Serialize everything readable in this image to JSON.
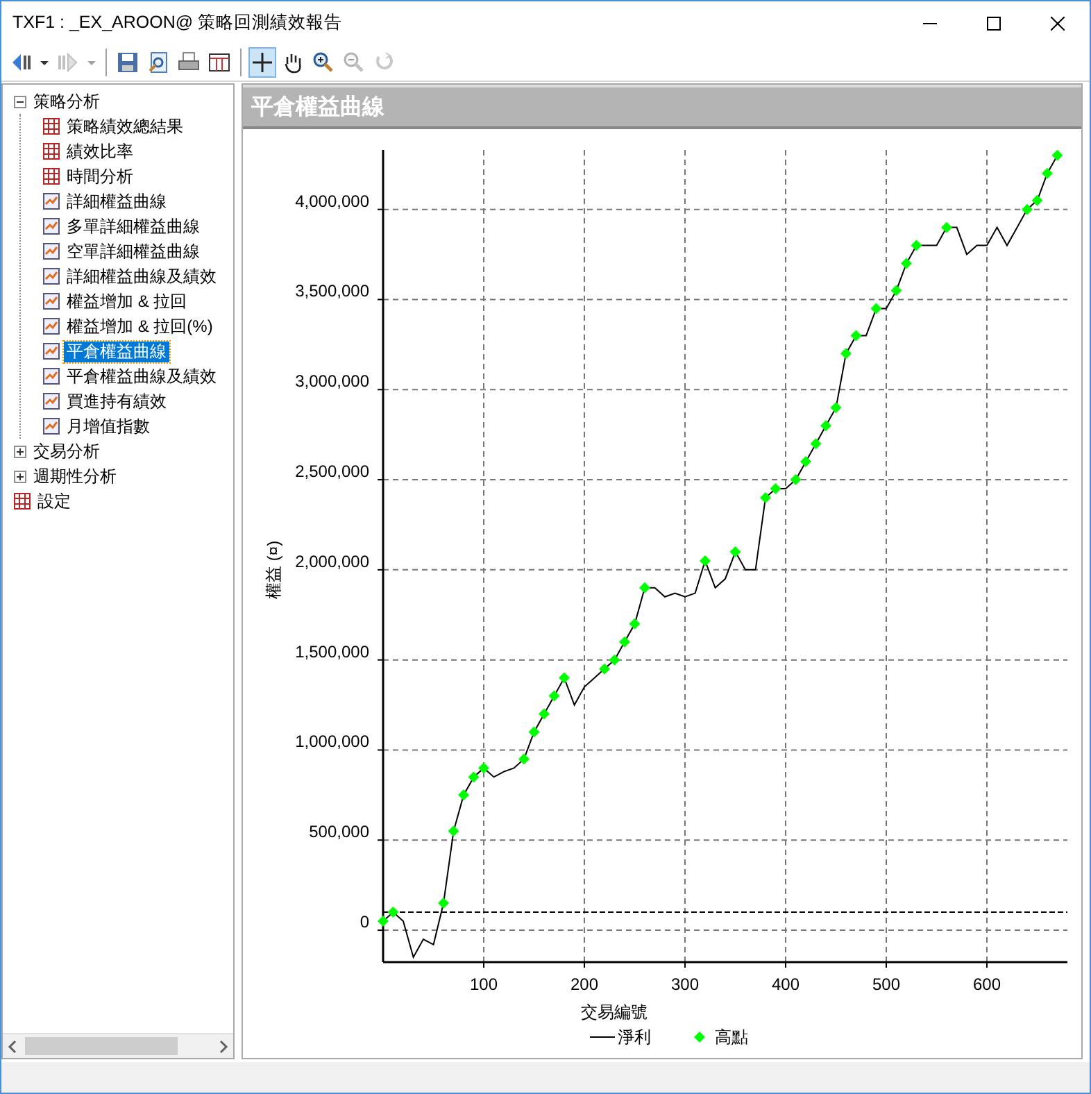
{
  "window": {
    "title": "TXF1 : _EX_AROON@ 策略回測績效報告"
  },
  "toolbar": [
    {
      "kind": "back",
      "selected": false,
      "disabled": false
    },
    {
      "kind": "dropdown",
      "selected": false,
      "disabled": false
    },
    {
      "kind": "forward",
      "selected": false,
      "disabled": true
    },
    {
      "kind": "dropdown",
      "selected": false,
      "disabled": true
    },
    {
      "kind": "separator"
    },
    {
      "kind": "save",
      "selected": false,
      "disabled": false
    },
    {
      "kind": "preview",
      "selected": false,
      "disabled": false
    },
    {
      "kind": "print",
      "selected": false,
      "disabled": false
    },
    {
      "kind": "table",
      "selected": false,
      "disabled": false
    },
    {
      "kind": "separator"
    },
    {
      "kind": "crosshair",
      "selected": true,
      "disabled": false
    },
    {
      "kind": "hand",
      "selected": false,
      "disabled": false
    },
    {
      "kind": "zoom-in",
      "selected": false,
      "disabled": false
    },
    {
      "kind": "zoom-out",
      "selected": false,
      "disabled": true
    },
    {
      "kind": "reset",
      "selected": false,
      "disabled": true
    }
  ],
  "tree": [
    {
      "label": "策略分析",
      "kind": "group",
      "expanded": true,
      "selected": false,
      "children": [
        {
          "label": "策略績效總結果",
          "kind": "table",
          "selected": false
        },
        {
          "label": "績效比率",
          "kind": "table",
          "selected": false
        },
        {
          "label": "時間分析",
          "kind": "table",
          "selected": false
        },
        {
          "label": "詳細權益曲線",
          "kind": "chart",
          "selected": false
        },
        {
          "label": "多單詳細權益曲線",
          "kind": "chart",
          "selected": false
        },
        {
          "label": "空單詳細權益曲線",
          "kind": "chart",
          "selected": false
        },
        {
          "label": "詳細權益曲線及績效",
          "kind": "chart",
          "selected": false
        },
        {
          "label": "權益增加 & 拉回",
          "kind": "chart",
          "selected": false
        },
        {
          "label": "權益增加 & 拉回(%)",
          "kind": "chart",
          "selected": false
        },
        {
          "label": "平倉權益曲線",
          "kind": "chart",
          "selected": true
        },
        {
          "label": "平倉權益曲線及績效",
          "kind": "chart",
          "selected": false
        },
        {
          "label": "買進持有績效",
          "kind": "chart",
          "selected": false
        },
        {
          "label": "月增值指數",
          "kind": "chart",
          "selected": false
        }
      ]
    },
    {
      "label": "交易分析",
      "kind": "group",
      "expanded": false,
      "selected": false
    },
    {
      "label": "週期性分析",
      "kind": "group",
      "expanded": false,
      "selected": false
    },
    {
      "label": "設定",
      "kind": "table",
      "selected": false
    }
  ],
  "panel": {
    "title": "平倉權益曲線",
    "chart_data": {
      "type": "line",
      "xlabel": "交易編號",
      "ylabel": "權益 (¤)",
      "x": [
        0,
        10,
        20,
        30,
        40,
        50,
        60,
        70,
        80,
        90,
        100,
        110,
        120,
        130,
        140,
        150,
        160,
        170,
        180,
        190,
        200,
        210,
        220,
        230,
        240,
        250,
        260,
        270,
        280,
        290,
        300,
        310,
        320,
        330,
        340,
        350,
        360,
        370,
        380,
        390,
        400,
        410,
        420,
        430,
        440,
        450,
        460,
        470,
        480,
        490,
        500,
        510,
        520,
        530,
        540,
        550,
        560,
        570,
        580,
        590,
        600,
        610,
        620,
        630,
        640,
        650,
        660,
        670
      ],
      "series": [
        {
          "name": "淨利",
          "color": "#000000",
          "values": [
            50000,
            100000,
            50000,
            -150000,
            -50000,
            -80000,
            150000,
            550000,
            750000,
            850000,
            900000,
            850000,
            880000,
            900000,
            950000,
            1100000,
            1200000,
            1300000,
            1400000,
            1250000,
            1350000,
            1400000,
            1450000,
            1500000,
            1600000,
            1700000,
            1900000,
            1900000,
            1850000,
            1870000,
            1850000,
            1870000,
            2050000,
            1900000,
            1950000,
            2100000,
            2000000,
            2000000,
            2400000,
            2450000,
            2450000,
            2500000,
            2600000,
            2700000,
            2800000,
            2900000,
            3200000,
            3300000,
            3300000,
            3450000,
            3450000,
            3550000,
            3700000,
            3800000,
            3800000,
            3800000,
            3900000,
            3900000,
            3750000,
            3800000,
            3800000,
            3900000,
            3800000,
            3900000,
            4000000,
            4050000,
            4200000,
            4300000
          ]
        },
        {
          "name": "高點",
          "color": "#00ff00",
          "type": "scatter",
          "values": [
            50000,
            100000,
            null,
            null,
            null,
            null,
            150000,
            550000,
            750000,
            850000,
            900000,
            null,
            null,
            null,
            950000,
            1100000,
            1200000,
            1300000,
            1400000,
            null,
            null,
            null,
            1450000,
            1500000,
            1600000,
            1700000,
            1900000,
            null,
            null,
            null,
            null,
            null,
            2050000,
            null,
            null,
            2100000,
            null,
            null,
            2400000,
            2450000,
            null,
            2500000,
            2600000,
            2700000,
            2800000,
            2900000,
            3200000,
            3300000,
            null,
            3450000,
            null,
            3550000,
            3700000,
            3800000,
            null,
            null,
            3900000,
            null,
            null,
            null,
            null,
            null,
            null,
            null,
            4000000,
            4050000,
            4200000,
            4300000
          ]
        }
      ],
      "xlim": [
        0,
        680
      ],
      "ylim": [
        -177000,
        4330000
      ],
      "xticks": [
        100,
        200,
        300,
        400,
        500,
        600
      ],
      "yticks": [
        {
          "value": 0,
          "label": "0"
        },
        {
          "value": 500000,
          "label": "500,000"
        },
        {
          "value": 1000000,
          "label": "1,000,000"
        },
        {
          "value": 1500000,
          "label": "1,500,000"
        },
        {
          "value": 2000000,
          "label": "2,000,000"
        },
        {
          "value": 2500000,
          "label": "2,500,000"
        },
        {
          "value": 3000000,
          "label": "3,000,000"
        },
        {
          "value": 3500000,
          "label": "3,500,000"
        },
        {
          "value": 4000000,
          "label": "4,000,000"
        }
      ],
      "grid": true,
      "ref_lines": [
        {
          "axis": "y",
          "value": 100000
        }
      ],
      "legend": true
    }
  }
}
